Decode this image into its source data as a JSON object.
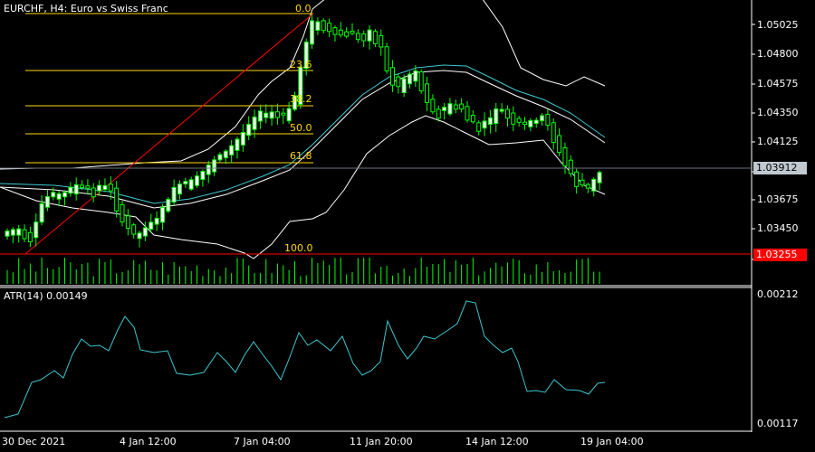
{
  "header": {
    "symbol_info": "EURCHF, H4:  Euro vs Swiss Franc"
  },
  "atr_panel": {
    "label": "ATR(14) 0.00149",
    "price_labels": [
      "0.00212",
      "0.00117"
    ]
  },
  "price_scale": {
    "labels": [
      "1.05025",
      "1.04800",
      "1.04575",
      "1.04350",
      "1.04125",
      "1.03675",
      "1.03450"
    ],
    "last_price": "1.03912",
    "low_line_price": "1.03255"
  },
  "time_axis": {
    "labels": [
      "30 Dec 2021",
      "4 Jan 12:00",
      "7 Jan 04:00",
      "11 Jan 20:00",
      "14 Jan 12:00",
      "19 Jan 04:00"
    ]
  },
  "fibonacci": {
    "levels": [
      "0.0",
      "23.6",
      "38.2",
      "50.0",
      "61.8",
      "100.0"
    ]
  },
  "colors": {
    "background": "#000000",
    "candle_up": "#00ff00",
    "candle_down_body": "#ffffff",
    "fib_line": "#ffd700",
    "fib_trend": "#ff0000",
    "bollinger": "#ffffff",
    "moving_average": "#3ec7cf",
    "atr_line": "#3ec7cf",
    "volume": "#00ff00",
    "low_line": "#ff0000",
    "grid_border": "#ffffff"
  }
}
